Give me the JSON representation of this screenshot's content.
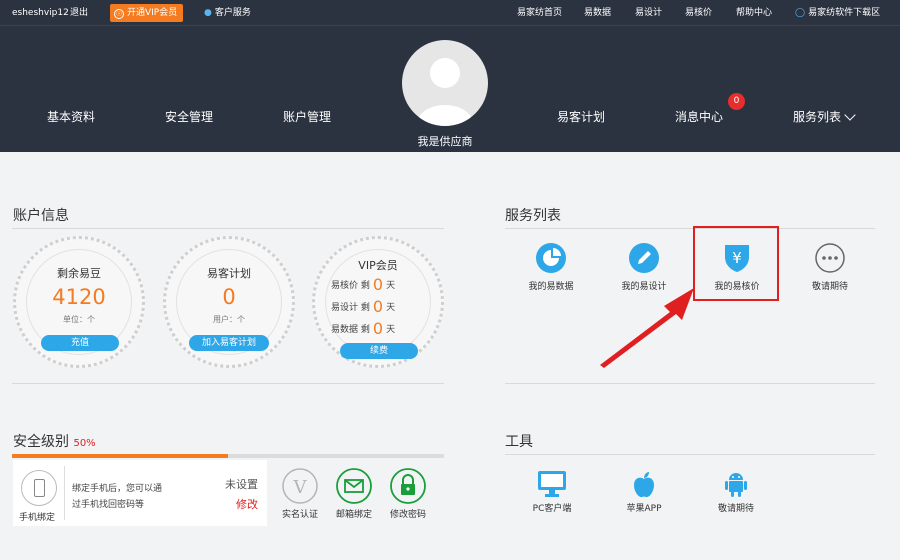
{
  "topbar": {
    "username": "esheshvip12",
    "logout": "退出",
    "vip_button": "开通VIP会员",
    "customer_service": "客户服务",
    "links": [
      "易家纺首页",
      "易数据",
      "易设计",
      "易核价",
      "帮助中心"
    ],
    "download": "易家纺软件下载区"
  },
  "header": {
    "nav_left": [
      "基本资料",
      "安全管理",
      "账户管理"
    ],
    "nav_right": [
      "易客计划",
      "消息中心",
      "服务列表"
    ],
    "role": "我是供应商",
    "message_count": "0"
  },
  "account": {
    "title": "账户信息",
    "beans": {
      "title": "剩余易豆",
      "value": "4120",
      "unit": "单位：个",
      "button": "充值"
    },
    "plan": {
      "title": "易客计划",
      "value": "0",
      "unit": "用户：个",
      "button": "加入易客计划"
    },
    "vip": {
      "title": "VIP会员",
      "rows": [
        {
          "label": "易核价 剩",
          "value": "0",
          "unit": "天"
        },
        {
          "label": "易设计 剩",
          "value": "0",
          "unit": "天"
        },
        {
          "label": "易数据 剩",
          "value": "0",
          "unit": "天"
        }
      ],
      "button": "续费"
    }
  },
  "services": {
    "title": "服务列表",
    "items": [
      "我的易数据",
      "我的易设计",
      "我的易核价",
      "敬请期待"
    ]
  },
  "security": {
    "title": "安全级别",
    "level": "50%",
    "progress": 0.5,
    "phone": {
      "label": "手机绑定",
      "desc_line1": "绑定手机后，您可以通",
      "desc_line2": "过手机找回密码等",
      "status": "未设置",
      "action": "修改"
    },
    "items": [
      "实名认证",
      "邮箱绑定",
      "修改密码"
    ]
  },
  "tools": {
    "title": "工具",
    "items": [
      "PC客户端",
      "苹果APP",
      "敬请期待"
    ]
  },
  "colors": {
    "header": "#2b3341",
    "accent": "#f47b20",
    "blue": "#2ea7e8",
    "green": "#1a9e3a",
    "red": "#e02020"
  }
}
